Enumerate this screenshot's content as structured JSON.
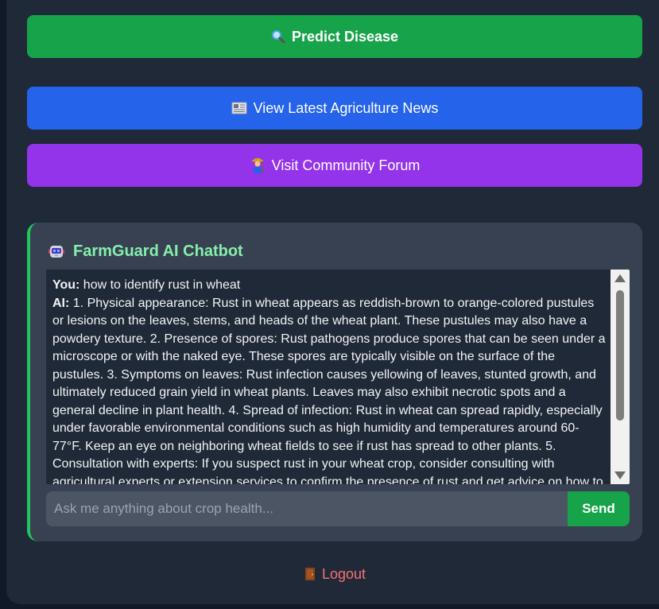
{
  "buttons": {
    "predict": {
      "label": "Predict Disease",
      "icon": "magnifier-icon"
    },
    "news": {
      "label": "View Latest Agriculture News",
      "icon": "newspaper-icon"
    },
    "forum": {
      "label": "Visit Community Forum",
      "icon": "farmer-icon"
    }
  },
  "chatbot": {
    "title": "FarmGuard AI Chatbot",
    "icon": "robot-icon",
    "messages": [
      {
        "speaker": "You:",
        "text": " how to identify rust in wheat"
      },
      {
        "speaker": "AI:",
        "text": " 1. Physical appearance: Rust in wheat appears as reddish-brown to orange-colored pustules or lesions on the leaves, stems, and heads of the wheat plant. These pustules may also have a powdery texture. 2. Presence of spores: Rust pathogens produce spores that can be seen under a microscope or with the naked eye. These spores are typically visible on the surface of the pustules. 3. Symptoms on leaves: Rust infection causes yellowing of leaves, stunted growth, and ultimately reduced grain yield in wheat plants. Leaves may also exhibit necrotic spots and a general decline in plant health. 4. Spread of infection: Rust in wheat can spread rapidly, especially under favorable environmental conditions such as high humidity and temperatures around 60-77°F. Keep an eye on neighboring wheat fields to see if rust has spread to other plants. 5. Consultation with experts: If you suspect rust in your wheat crop, consider consulting with agricultural experts or extension services to confirm the presence of rust and get advice on how to manage and control the disease. They may"
      }
    ],
    "input_placeholder": "Ask me anything about crop health...",
    "input_value": "",
    "send_label": "Send"
  },
  "logout": {
    "label": "Logout",
    "icon": "door-icon"
  },
  "colors": {
    "predict_bg": "#16a34a",
    "news_bg": "#2563eb",
    "forum_bg": "#9333ea",
    "chat_title": "#86efac",
    "logout_text": "#f87171"
  }
}
